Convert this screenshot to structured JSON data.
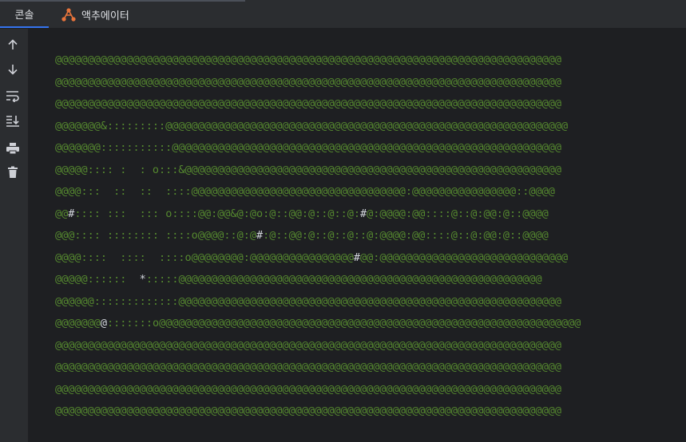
{
  "tabs": [
    {
      "label": "콘솔",
      "active": true
    },
    {
      "label": "액추에이터",
      "active": false,
      "icon": "actuator-icon"
    }
  ],
  "toolbar": {
    "buttons": [
      "arrow-up-icon",
      "arrow-down-icon",
      "soft-wrap-icon",
      "scroll-to-end-icon",
      "print-icon",
      "clear-icon"
    ]
  },
  "colors": {
    "console_bg": "#1e1f22",
    "panel_bg": "#2b2d30",
    "green_text": "#55892f",
    "grey_text": "#d2d6dc",
    "active_tab_underline": "#3574f0"
  },
  "console": {
    "lines": [
      [
        {
          "t": "@@@@@@@@@@@@@@@@@@@@@@@@@@@@@@@@@@@@@@@@@@@@@@@@@@@@@@@@@@@@@@@@@@@@@@@@@@@@@@",
          "c": "g"
        }
      ],
      [
        {
          "t": "@@@@@@@@@@@@@@@@@@@@@@@@@@@@@@@@@@@@@@@@@@@@@@@@@@@@@@@@@@@@@@@@@@@@@@@@@@@@@@",
          "c": "g"
        }
      ],
      [
        {
          "t": "@@@@@@@@@@@@@@@@@@@@@@@@@@@@@@@@@@@@@@@@@@@@@@@@@@@@@@@@@@@@@@@@@@@@@@@@@@@@@@",
          "c": "g"
        }
      ],
      [
        {
          "t": "@@@@@@@&:::::::::@@@@@@@@@@@@@@@@@@@@@@@@@@@@@@@@@@@@@@@@@@@@@@@@@@@@@@@@@@@@@@",
          "c": "g"
        }
      ],
      [
        {
          "t": "@@@@@@@:::::::::::@@@@@@@@@@@@@@@@@@@@@@@@@@@@@@@@@@@@@@@@@@@@@@@@@@@@@@@@@@@@",
          "c": "g"
        }
      ],
      [
        {
          "t": "@@@@@:::: :  : o:::&@@@@@@@@@@@@@@@@@@@@@@@@@@@@@@@@@@@@@@@@@@@@@@@@@@@@@@@@@@",
          "c": "g"
        }
      ],
      [
        {
          "t": "@@@@:::  ::  ::  ::::@@@@@@@@@@@@@@@@@@@@@@@@@@@@@@@@@:@@@@@@@@@@@@@@@@::@@@@",
          "c": "g"
        }
      ],
      [
        {
          "t": "@@",
          "c": "g"
        },
        {
          "t": "#",
          "c": "d"
        },
        {
          "t": ":::: :::  ::: o::::@@:@@&@:@o:@::@@:@::@::@:",
          "c": "g"
        },
        {
          "t": "#",
          "c": "d"
        },
        {
          "t": "@:@@@@:@@::::@::@:@@:@::@@@@",
          "c": "g"
        }
      ],
      [
        {
          "t": "@@@:::: :::::::: ::::o@@@@::@:@",
          "c": "g"
        },
        {
          "t": "#",
          "c": "d"
        },
        {
          "t": ":@::@@:@::@::@::@:@@@@:@@::::@::@:@@:@::@@@@",
          "c": "g"
        }
      ],
      [
        {
          "t": "@@@@::::  ::::  ::::o@@@@@@@@:@@@@@@@@@@@@@@@@",
          "c": "g"
        },
        {
          "t": "#",
          "c": "d"
        },
        {
          "t": "@@:@@@@@@@@@@@@@@@@@@@@@@@@@@@@@",
          "c": "g"
        }
      ],
      [
        {
          "t": "@@@@@::::::  ",
          "c": "g"
        },
        {
          "t": "*",
          "c": "d"
        },
        {
          "t": ":::::@@@@@@@@@@@@@@@@@@@@@@@@@@@@@@@@@@@@@@@@@@@@@@@@@@@@@@@@",
          "c": "g"
        }
      ],
      [
        {
          "t": "@@@@@@:::::::::::::@@@@@@@@@@@@@@@@@@@@@@@@@@@@@@@@@@@@@@@@@@@@@@@@@@@@@@@@@@@",
          "c": "g"
        }
      ],
      [
        {
          "t": "@@@@@@@",
          "c": "g"
        },
        {
          "t": "@",
          "c": "d"
        },
        {
          "t": ":::::::o@@@@@@@@@@@@@@@@@@@@@@@@@@@@@@@@@@@@@@@@@@@@@@@@@@@@@@@@@@@@@@@@@",
          "c": "g"
        }
      ],
      [
        {
          "t": "@@@@@@@@@@@@@@@@@@@@@@@@@@@@@@@@@@@@@@@@@@@@@@@@@@@@@@@@@@@@@@@@@@@@@@@@@@@@@@",
          "c": "g"
        }
      ],
      [
        {
          "t": "@@@@@@@@@@@@@@@@@@@@@@@@@@@@@@@@@@@@@@@@@@@@@@@@@@@@@@@@@@@@@@@@@@@@@@@@@@@@@@",
          "c": "g"
        }
      ],
      [
        {
          "t": "@@@@@@@@@@@@@@@@@@@@@@@@@@@@@@@@@@@@@@@@@@@@@@@@@@@@@@@@@@@@@@@@@@@@@@@@@@@@@@",
          "c": "g"
        }
      ],
      [
        {
          "t": "@@@@@@@@@@@@@@@@@@@@@@@@@@@@@@@@@@@@@@@@@@@@@@@@@@@@@@@@@@@@@@@@@@@@@@@@@@@@@@",
          "c": "g"
        }
      ]
    ]
  }
}
